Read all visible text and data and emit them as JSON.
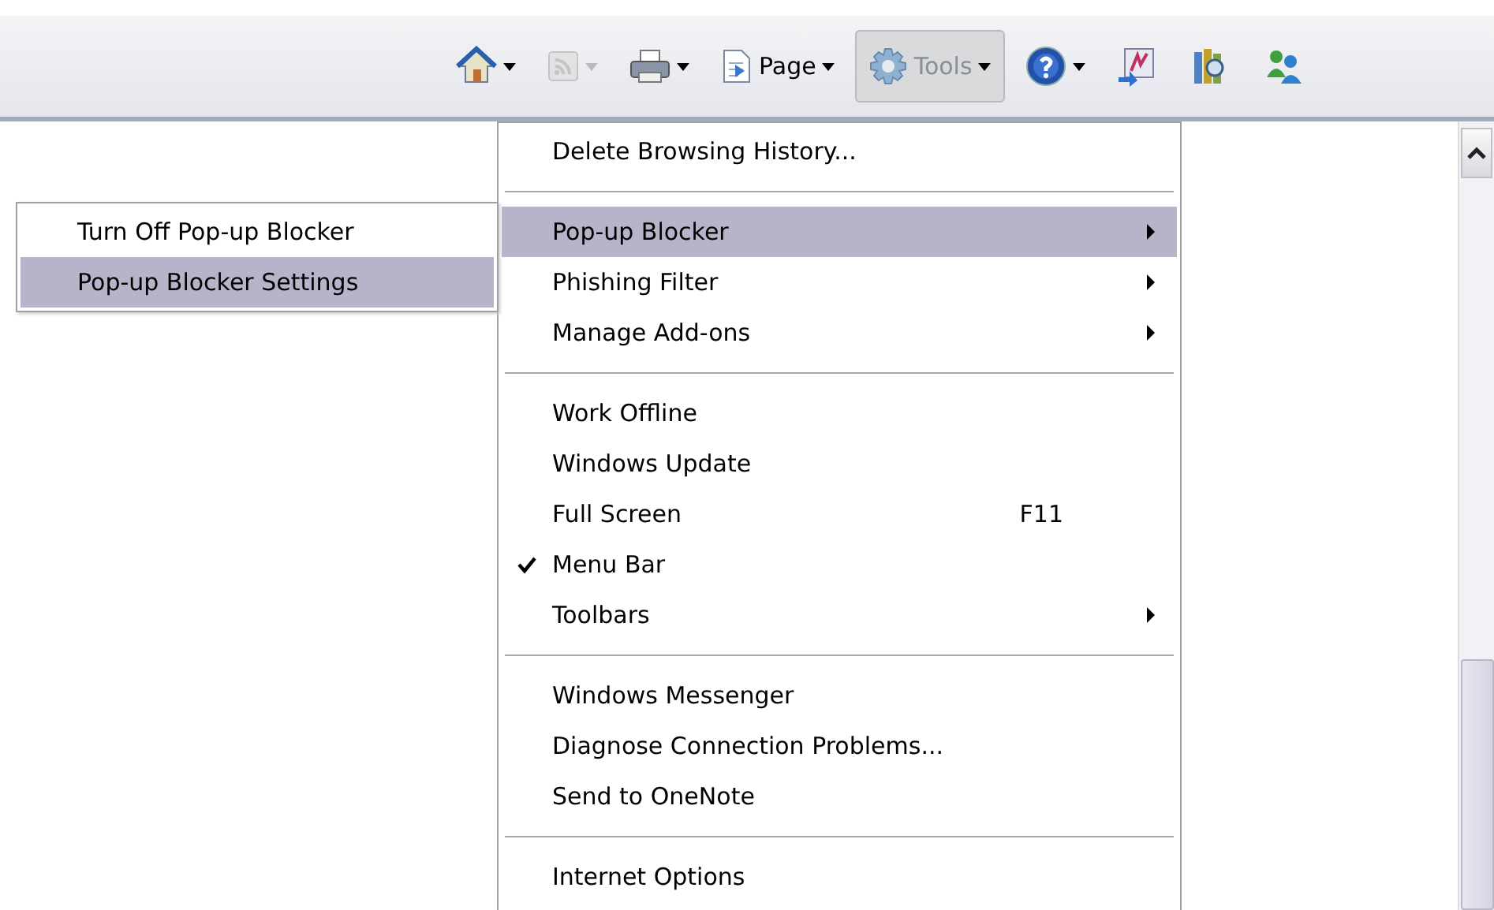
{
  "toolbar": {
    "items": [
      {
        "dropdown": true,
        "disabled": false,
        "pressed": false
      },
      {
        "dropdown": true,
        "disabled": true,
        "pressed": false
      },
      {
        "dropdown": true,
        "disabled": false,
        "pressed": false
      },
      {
        "label": "Page",
        "dropdown": true,
        "disabled": false,
        "pressed": false
      },
      {
        "label": "Tools",
        "dropdown": true,
        "disabled": false,
        "pressed": true
      },
      {
        "dropdown": true,
        "disabled": false,
        "pressed": false
      },
      {
        "dropdown": false,
        "disabled": false,
        "pressed": false
      },
      {
        "dropdown": false,
        "disabled": false,
        "pressed": false
      },
      {
        "dropdown": false,
        "disabled": false,
        "pressed": false
      }
    ]
  },
  "submenu": {
    "items": [
      {
        "label": "Turn Off Pop-up Blocker",
        "selected": false
      },
      {
        "label": "Pop-up Blocker Settings",
        "selected": true
      }
    ]
  },
  "menu": {
    "items": [
      {
        "kind": "item",
        "label": "Delete Browsing History...",
        "submenu": false,
        "checked": false,
        "selected": false
      },
      {
        "kind": "separator"
      },
      {
        "kind": "item",
        "label": "Pop-up Blocker",
        "submenu": true,
        "checked": false,
        "selected": true
      },
      {
        "kind": "item",
        "label": "Phishing Filter",
        "submenu": true,
        "checked": false,
        "selected": false
      },
      {
        "kind": "item",
        "label": "Manage Add-ons",
        "submenu": true,
        "checked": false,
        "selected": false
      },
      {
        "kind": "separator"
      },
      {
        "kind": "item",
        "label": "Work Offline",
        "submenu": false,
        "checked": false,
        "selected": false
      },
      {
        "kind": "item",
        "label": "Windows Update",
        "submenu": false,
        "checked": false,
        "selected": false
      },
      {
        "kind": "item",
        "label": "Full Screen",
        "shortcut": "F11",
        "submenu": false,
        "checked": false,
        "selected": false
      },
      {
        "kind": "item",
        "label": "Menu Bar",
        "submenu": false,
        "checked": true,
        "selected": false
      },
      {
        "kind": "item",
        "label": "Toolbars",
        "submenu": true,
        "checked": false,
        "selected": false
      },
      {
        "kind": "separator"
      },
      {
        "kind": "item",
        "label": "Windows Messenger",
        "submenu": false,
        "checked": false,
        "selected": false
      },
      {
        "kind": "item",
        "label": "Diagnose Connection Problems...",
        "submenu": false,
        "checked": false,
        "selected": false
      },
      {
        "kind": "item",
        "label": "Send to OneNote",
        "submenu": false,
        "checked": false,
        "selected": false
      },
      {
        "kind": "separator"
      },
      {
        "kind": "item",
        "label": "Internet Options",
        "submenu": false,
        "checked": false,
        "selected": false
      }
    ]
  }
}
